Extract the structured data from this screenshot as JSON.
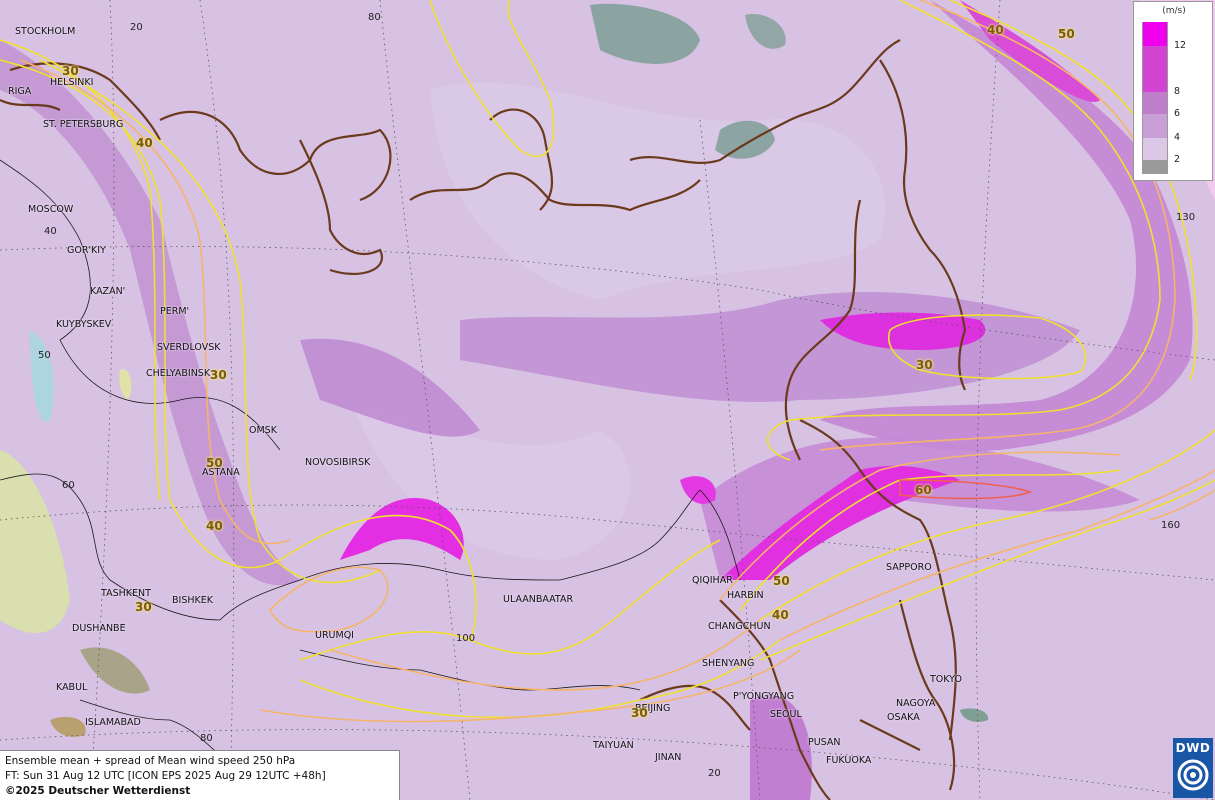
{
  "legend": {
    "unit": "(m/s)",
    "levels": [
      "12",
      "8",
      "6",
      "4",
      "2"
    ],
    "colors": [
      "#ee00ee",
      "#d244d2",
      "#bf7ec9",
      "#c89fd6",
      "#ddc7e6",
      "#9a9a9a"
    ]
  },
  "info": {
    "line1": "Ensemble mean + spread of Mean wind speed 250 hPa",
    "line2": "FT: Sun 31 Aug 12 UTC [ICON EPS 2025 Aug 29 12UTC +48h]",
    "copyright": "©2025 Deutscher Wetterdienst"
  },
  "logo": {
    "text": "DWD",
    "colors": {
      "bg": "#1a56a6",
      "fg": "#ffffff"
    }
  },
  "cities": {
    "stockholm": "STOCKHOLM",
    "helsinki": "HELSINKI",
    "riga": "RIGA",
    "st_petersburg": "ST. PETERSBURG",
    "moscow": "MOSCOW",
    "gorkiy": "GOR'KIY",
    "kazan": "KAZAN'",
    "kuybyshev": "KUYBYSKEV",
    "perm": "PERM'",
    "sverdlovsk": "SVERDLOVSK",
    "chelyabinsk": "CHELYABINSK",
    "omsk": "OMSK",
    "novosibirsk": "NOVOSIBIRSK",
    "astana": "ASTANA",
    "tashkent": "TASHKENT",
    "bishkek": "BISHKEK",
    "dushanbe": "DUSHANBE",
    "kabul": "KABUL",
    "islamabad": "ISLAMABAD",
    "urumqi": "URUMQI",
    "ulaanbaatar": "ULAANBAATAR",
    "qiqihar": "QIQIHAR",
    "harbin": "HARBIN",
    "changchun": "CHANGCHUN",
    "shenyang": "SHENYANG",
    "pyongyang": "P'YONGYANG",
    "seoul": "SEOUL",
    "pusan": "PUSAN",
    "fukuoka": "FUKUOKA",
    "beijing": "BEIJING",
    "taiyuan": "TAIYUAN",
    "jinan": "JINAN",
    "sapporo": "SAPPORO",
    "tokyo": "TOKYO",
    "nagoya": "NAGOYA",
    "osaka": "OSAKA"
  },
  "grid_labels": {
    "g20_top": "20",
    "g80_top": "80",
    "g40_left": "40",
    "g50_left": "50",
    "g60_left": "60",
    "g80_bottom": "80",
    "g100": "100",
    "g130": "130",
    "g160": "160",
    "g20_bottom": "20"
  },
  "contour_labels": {
    "c30_a": "30",
    "c40_a": "40",
    "c30_b": "30",
    "c50_a": "50",
    "c40_b": "40",
    "c30_c": "30",
    "c40_top": "40",
    "c50_top": "50",
    "c30_east": "30",
    "c60": "60",
    "c50_b": "50",
    "c40_c": "40",
    "c30_d": "30"
  }
}
